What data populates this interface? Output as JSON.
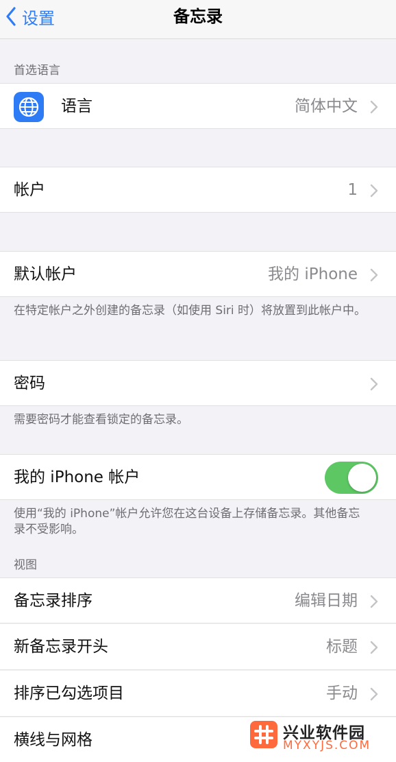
{
  "navbar": {
    "back_label": "设置",
    "title": "备忘录"
  },
  "language_section": {
    "header": "首选语言",
    "row": {
      "icon": "globe-icon",
      "label": "语言",
      "value": "简体中文"
    }
  },
  "accounts_row": {
    "label": "帐户",
    "value": "1"
  },
  "default_account": {
    "label": "默认帐户",
    "value": "我的 iPhone",
    "footer": "在特定帐户之外创建的备忘录（如使用 Siri 时）将放置到此帐户中。"
  },
  "password": {
    "label": "密码",
    "footer": "需要密码才能查看锁定的备忘录。"
  },
  "iphone_account": {
    "label": "我的 iPhone 帐户",
    "toggle_on": true,
    "footer": "使用“我的 iPhone”帐户允许您在这台设备上存储备忘录。其他备忘录不受影响。"
  },
  "view_section": {
    "header": "视图",
    "rows": [
      {
        "label": "备忘录排序",
        "value": "编辑日期"
      },
      {
        "label": "新备忘录开头",
        "value": "标题"
      },
      {
        "label": "排序已勾选项目",
        "value": "手动"
      },
      {
        "label": "横线与网格",
        "value": ""
      }
    ]
  },
  "watermark": {
    "title": "兴业软件园",
    "subtitle": "MYXYJS.COM"
  },
  "colors": {
    "accent": "#2f7cf6",
    "toggle_on": "#5dc764",
    "background": "#f2f2f7",
    "secondary_text": "#8a8a8e"
  }
}
